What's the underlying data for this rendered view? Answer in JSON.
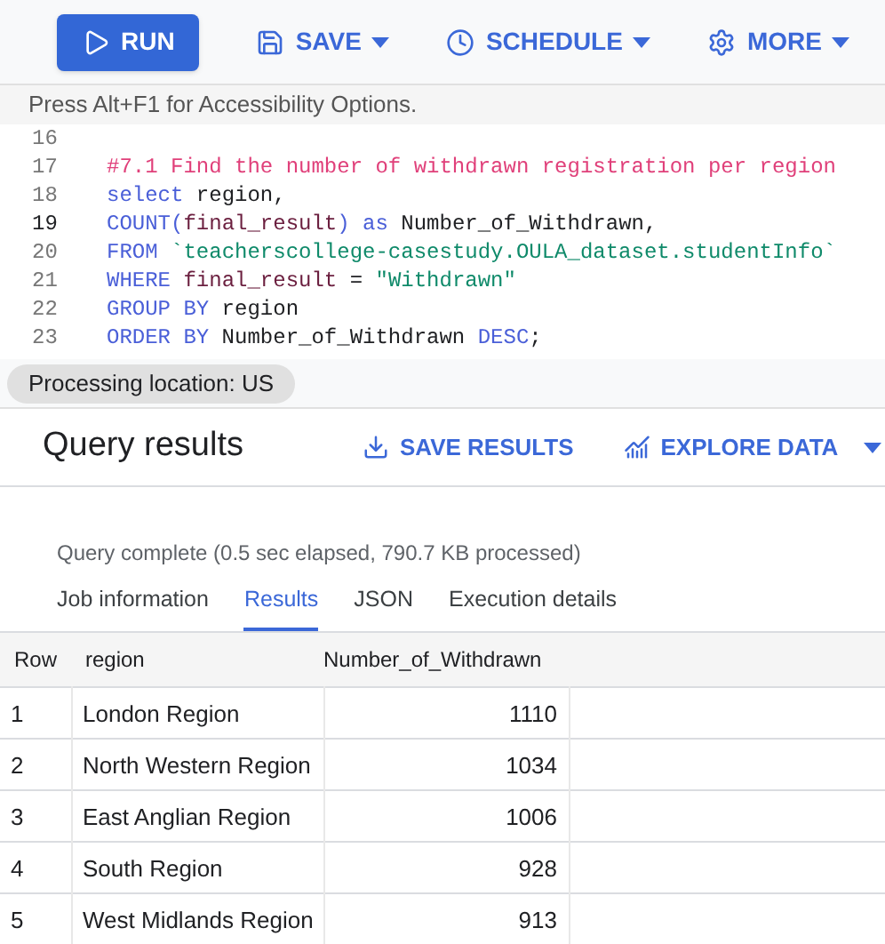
{
  "toolbar": [
    {
      "kind": "primary",
      "label": "RUN"
    },
    {
      "kind": "menu",
      "label": "SAVE"
    },
    {
      "kind": "menu",
      "label": "SCHEDULE"
    },
    {
      "kind": "menu",
      "label": "MORE"
    }
  ],
  "accessibility_hint": "Press Alt+F1 for Accessibility Options.",
  "editor": {
    "lines": [
      {
        "number": "16",
        "current": false
      },
      {
        "number": "17",
        "current": false,
        "tokens": [
          {
            "kind": "comment",
            "text": "#7.1 Find the number of withdrawn registration per region"
          }
        ]
      },
      {
        "number": "18",
        "current": false,
        "tokens": [
          {
            "kind": "keyword",
            "text": "select"
          },
          {
            "kind": "plain",
            "text": " region,"
          }
        ]
      },
      {
        "number": "19",
        "current": true,
        "tokens": [
          {
            "kind": "keyword",
            "text": "COUNT("
          },
          {
            "kind": "column",
            "text": "final_result"
          },
          {
            "kind": "keyword",
            "text": ") as"
          },
          {
            "kind": "plain",
            "text": " Number_of_Withdrawn,"
          }
        ]
      },
      {
        "number": "20",
        "current": false,
        "tokens": [
          {
            "kind": "keyword",
            "text": "FROM"
          },
          {
            "kind": "string",
            "text": " `teacherscollege-casestudy.OULA_dataset.studentInfo`"
          }
        ]
      },
      {
        "number": "21",
        "current": false,
        "tokens": [
          {
            "kind": "keyword",
            "text": "WHERE"
          },
          {
            "kind": "column",
            "text": " final_result"
          },
          {
            "kind": "plain",
            "text": " = "
          },
          {
            "kind": "string",
            "text": "\"Withdrawn\""
          }
        ]
      },
      {
        "number": "22",
        "current": false,
        "tokens": [
          {
            "kind": "keyword",
            "text": "GROUP BY"
          },
          {
            "kind": "plain",
            "text": " region"
          }
        ]
      },
      {
        "number": "23",
        "current": false,
        "tokens": [
          {
            "kind": "keyword",
            "text": "ORDER BY"
          },
          {
            "kind": "plain",
            "text": " Number_of_Withdrawn "
          },
          {
            "kind": "keyword",
            "text": "DESC"
          },
          {
            "kind": "plain",
            "text": ";"
          }
        ]
      }
    ]
  },
  "processing_location": "Processing location: US",
  "results": {
    "title": "Query results",
    "actions": [
      {
        "label": "SAVE RESULTS",
        "dropdown": false
      },
      {
        "label": "EXPLORE DATA",
        "dropdown": true
      }
    ],
    "status": "Query complete (0.5 sec elapsed, 790.7 KB processed)",
    "tabs": [
      {
        "label": "Job information",
        "selected": false
      },
      {
        "label": "Results",
        "selected": true
      },
      {
        "label": "JSON",
        "selected": false
      },
      {
        "label": "Execution details",
        "selected": false
      }
    ],
    "table": {
      "columns": [
        "Row",
        "region",
        "Number_of_Withdrawn"
      ],
      "rows": [
        [
          "1",
          "London Region",
          "1110"
        ],
        [
          "2",
          "North Western Region",
          "1034"
        ],
        [
          "3",
          "East Anglian Region",
          "1006"
        ],
        [
          "4",
          "South Region",
          "928"
        ],
        [
          "5",
          "West Midlands Region",
          "913"
        ]
      ]
    }
  }
}
